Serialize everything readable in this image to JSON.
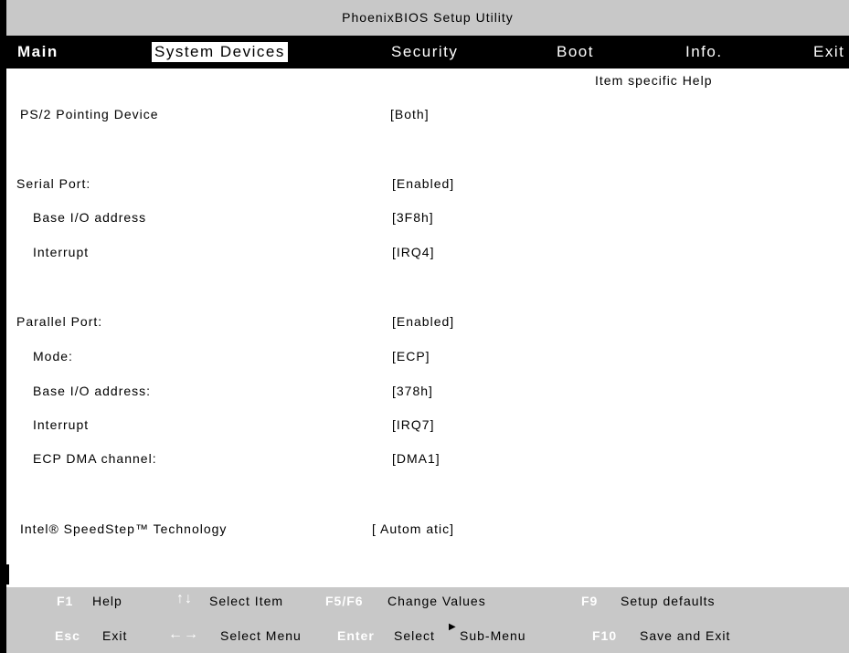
{
  "title": "PhoenixBIOS Setup Utility",
  "menu": {
    "main": "Main",
    "system_devices": "System Devices",
    "security": "Security",
    "boot": "Boot",
    "info": "Info.",
    "exit": "Exit"
  },
  "help_title": "Item specific Help",
  "rows": [
    {
      "label": "PS/2 Pointing Device",
      "value": "[Both]"
    },
    {
      "label": "Serial Port:",
      "value": "[Enabled]"
    },
    {
      "label": "Base I/O address",
      "value": "[3F8h]"
    },
    {
      "label": "Interrupt",
      "value": "[IRQ4]"
    },
    {
      "label": "Parallel Port:",
      "value": "[Enabled]"
    },
    {
      "label": "Mode:",
      "value": "[ECP]"
    },
    {
      "label": "Base I/O address:",
      "value": "[378h]"
    },
    {
      "label": "Interrupt",
      "value": "[IRQ7]"
    },
    {
      "label": "ECP DMA channel:",
      "value": "[DMA1]"
    },
    {
      "label": "Intel® SpeedStep™ Technology",
      "value": "[ Autom atic]"
    }
  ],
  "footer": {
    "f1_key": "F1",
    "f1_text": "Help",
    "arrows_ud": "↑↓",
    "select_item": "Select Item",
    "f5f6_key": "F5/F6",
    "change_values": "Change Values",
    "f9_key": "F9",
    "setup_defaults": "Setup defaults",
    "esc_key": "Esc",
    "exit_text": "Exit",
    "arrows_lr": "←→",
    "select_menu": "Select Menu",
    "enter_key": "Enter",
    "select_text": "Select",
    "submenu_arrow": "▶",
    "submenu_text": "Sub-Menu",
    "f10_key": "F10",
    "save_exit": "Save and Exit"
  }
}
